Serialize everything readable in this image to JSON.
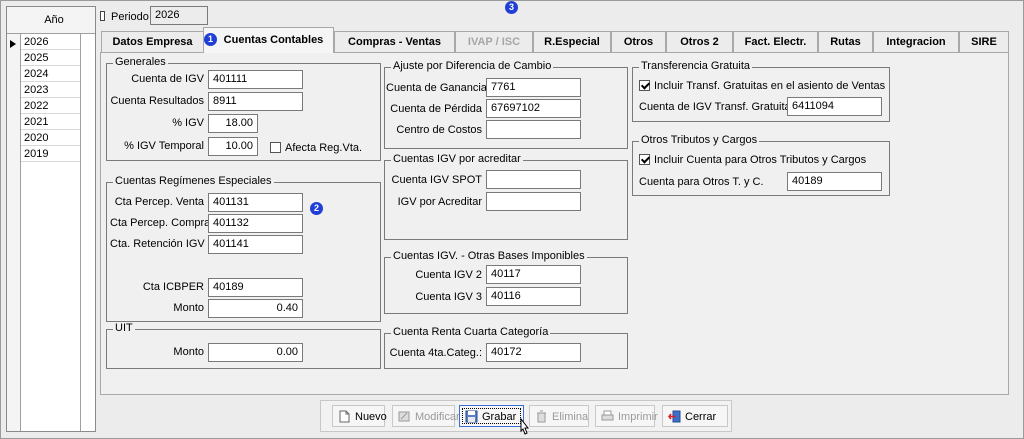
{
  "years_grid": {
    "header": "Año",
    "selected": "2026",
    "rows": [
      "2026",
      "2025",
      "2024",
      "2023",
      "2022",
      "2021",
      "2020",
      "2019"
    ]
  },
  "periodo": {
    "label": "Periodo",
    "value": "2026"
  },
  "tabs": [
    {
      "label": "Datos Empresa"
    },
    {
      "label": "Cuentas Contables"
    },
    {
      "label": "Compras - Ventas"
    },
    {
      "label": "IVAP / ISC"
    },
    {
      "label": "R.Especial"
    },
    {
      "label": "Otros"
    },
    {
      "label": "Otros 2"
    },
    {
      "label": "Fact. Electr."
    },
    {
      "label": "Rutas"
    },
    {
      "label": "Integracion"
    },
    {
      "label": "SIRE"
    }
  ],
  "badges": {
    "b1": "1",
    "b2": "2",
    "b3": "3"
  },
  "generales": {
    "title": "Generales",
    "cuenta_igv_label": "Cuenta de IGV",
    "cuenta_igv": "401111",
    "cuenta_resultados_label": "Cuenta Resultados",
    "cuenta_resultados": "8911",
    "pct_igv_label": "% IGV",
    "pct_igv": "18.00",
    "pct_igv_temporal_label": "% IGV Temporal",
    "pct_igv_temporal": "10.00",
    "afecta_label": "Afecta Reg.Vta."
  },
  "regimenes": {
    "title": "Cuentas Regímenes Especiales",
    "percep_venta_label": "Cta Percep. Venta",
    "percep_venta": "401131",
    "percep_compra_label": "Cta Percep. Compra",
    "percep_compra": "401132",
    "retencion_label": "Cta. Retención IGV",
    "retencion": "401141",
    "icbper_label": "Cta ICBPER",
    "icbper": "40189",
    "monto_label": "Monto",
    "monto": "0.40"
  },
  "uit": {
    "title": "UIT",
    "monto_label": "Monto",
    "monto": "0.00"
  },
  "ajuste": {
    "title": "Ajuste por Diferencia de Cambio",
    "ganancia_label": "Cuenta de Ganancia",
    "ganancia": "7761",
    "perdida_label": "Cuenta de Pérdida",
    "perdida": "67697102",
    "costos_label": "Centro de Costos",
    "costos": ""
  },
  "igv_acreditar": {
    "title": "Cuentas IGV por acreditar",
    "spot_label": "Cuenta IGV SPOT",
    "spot": "",
    "acreditar_label": "IGV por Acreditar",
    "acreditar": ""
  },
  "otras_bases": {
    "title": "Cuentas IGV. - Otras Bases Imponibles",
    "igv2_label": "Cuenta IGV 2",
    "igv2": "40117",
    "igv3_label": "Cuenta IGV 3",
    "igv3": "40116"
  },
  "renta_cuarta": {
    "title": "Cuenta Renta Cuarta Categoría",
    "label": "Cuenta 4ta.Categ.:",
    "value": "40172"
  },
  "transferencia": {
    "title": "Transferencia Gratuita",
    "check_label": "Incluir Transf. Gratuitas en el asiento de Ventas",
    "cuenta_label": "Cuenta de IGV Transf. Gratuita",
    "cuenta": "6411094"
  },
  "otros_tributos": {
    "title": "Otros Tributos y Cargos",
    "check_label": "Incluir Cuenta para Otros Tributos y Cargos",
    "cuenta_label": "Cuenta para Otros T. y C.",
    "cuenta": "40189"
  },
  "buttons": {
    "nuevo": "Nuevo",
    "modificar": "Modificar",
    "grabar": "Grabar",
    "elimina": "Elimina",
    "imprimir": "Imprimir",
    "cerrar": "Cerrar"
  },
  "colors": {
    "badge": "#1f3fd6",
    "selected_button_border": "#3a6fcf",
    "disabled_text": "#a6a6a6"
  }
}
